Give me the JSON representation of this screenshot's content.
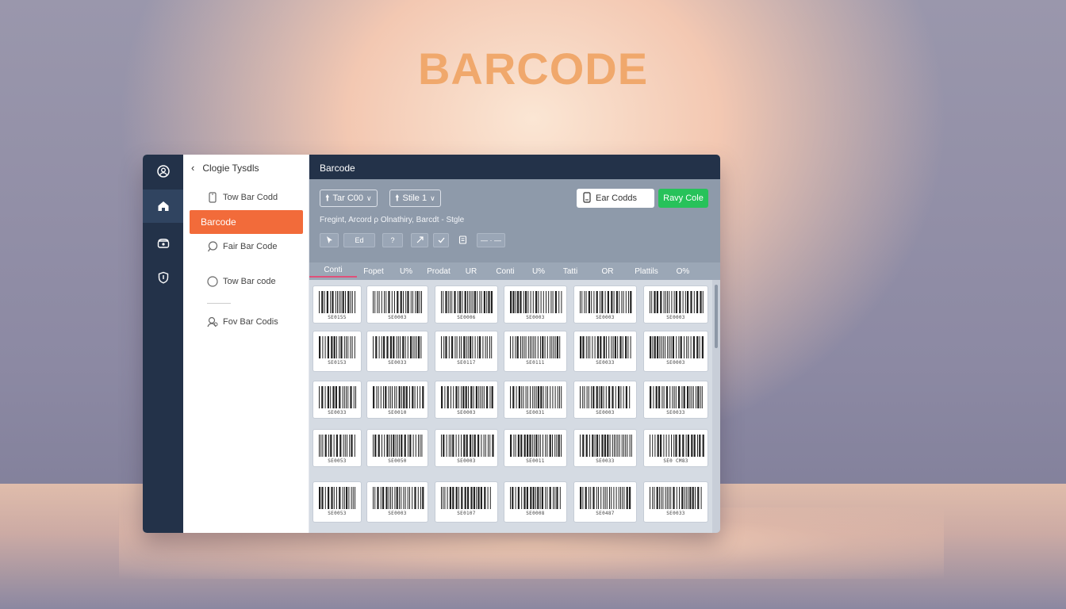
{
  "hero": {
    "title": "BARCODE"
  },
  "sidebar": {
    "back_label": "Clogie Tysdls",
    "items": [
      {
        "label": "Tow Bar Codd",
        "icon": "phone-icon"
      },
      {
        "label": "Barcode",
        "icon": "",
        "active": true
      },
      {
        "label": "Fair Bar Code",
        "icon": "search-icon"
      },
      {
        "label": "Tow Bar code",
        "icon": "circle-icon"
      },
      {
        "label": "Fov Bar Codis",
        "icon": "user-icon"
      }
    ]
  },
  "rail": {
    "icons": [
      "user-circle-icon",
      "home-icon",
      "phone-icon",
      "shield-icon"
    ],
    "active": "home-icon"
  },
  "main": {
    "title": "Barcode",
    "dropdown1": "Tar C00",
    "dropdown2": "Stile 1",
    "search_button": "Ear Codds",
    "new_button": "Ravy Cole",
    "subtitle": "Fregint, Arcord ρ Olnathiry, Barcdt - Stgle",
    "tools": [
      "",
      "Ed",
      "?",
      "",
      "",
      "",
      "— · —"
    ],
    "columns": [
      "Conti",
      "Fopet",
      "U%",
      "Prodat",
      "UR",
      "Conti",
      "U%",
      "Tatti",
      "OR",
      "Plattils",
      "O%"
    ]
  },
  "barcodes": [
    [
      "SE0155",
      "SE0003",
      "SE0006",
      "SE0003",
      "SE0003",
      "SE0003"
    ],
    [
      "SE0153",
      "SE0033",
      "SE0117",
      "SE0111",
      "SE0033",
      "SE0003"
    ],
    [
      "SE0033",
      "SE0010",
      "SE0003",
      "SE0031",
      "SE0003",
      "SE0033"
    ],
    [
      "SE0053",
      "SE0050",
      "SE0003",
      "SE0011",
      "SE0033",
      "SE0 CM83"
    ],
    [
      "SE0053",
      "SE0003",
      "SE0107",
      "SE0008",
      "SE0487",
      "SE0033"
    ]
  ],
  "colors": {
    "accent": "#f26b3a",
    "green": "#27c25a",
    "navy": "#233249",
    "title": "#f0a86c"
  }
}
